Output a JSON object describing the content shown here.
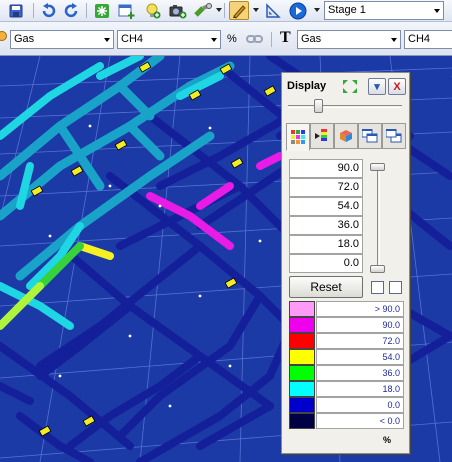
{
  "toolbar_top": {
    "buttons": [
      {
        "name": "save-icon"
      },
      {
        "name": "undo-icon"
      },
      {
        "name": "redo-icon"
      },
      {
        "name": "snowflake-icon"
      },
      {
        "name": "add-window-icon"
      },
      {
        "name": "bulb-icon"
      },
      {
        "name": "camera-icon"
      },
      {
        "name": "pipe-icon"
      },
      {
        "name": "pen-icon"
      },
      {
        "name": "measure-icon"
      },
      {
        "name": "play-icon"
      }
    ],
    "stage_select": "Stage 1"
  },
  "toolbar_bottom": {
    "color_by_type": "Gas",
    "color_by_field": "CH4",
    "color_units": "%",
    "text_icon": "T",
    "text_by_type": "Gas",
    "text_by_field": "CH4"
  },
  "display_panel": {
    "title": "Display",
    "collapse_label": "▾",
    "close_label": "X",
    "tabs": [
      "color-grid-icon",
      "color-scale-icon",
      "cube-icon",
      "window-front-icon",
      "window-back-icon"
    ],
    "active_tab": 0,
    "opacity_level": 0.25,
    "range_values": [
      "90.0",
      "72.0",
      "54.0",
      "36.0",
      "18.0",
      "0.0"
    ],
    "range_slider_level": 0.0,
    "reset_label": "Reset",
    "legend": [
      {
        "color": "#ff9bf7",
        "label": "> 90.0"
      },
      {
        "color": "#ee00ee",
        "label": "90.0"
      },
      {
        "color": "#ff0000",
        "label": "72.0"
      },
      {
        "color": "#ffff00",
        "label": "54.0"
      },
      {
        "color": "#00ff00",
        "label": "36.0"
      },
      {
        "color": "#00ffff",
        "label": "18.0"
      },
      {
        "color": "#0000cc",
        "label": "0.0"
      },
      {
        "color": "#000044",
        "label": "< 0.0"
      }
    ],
    "unit": "%"
  },
  "scene": {
    "background": "#1c3aa6",
    "grid_color": "#6f88e6",
    "airway_color_low": "#141f9a",
    "airway_color_cyan": "#1fd6e3",
    "airway_color_magenta": "#e91be6",
    "airway_color_yellow": "#f6ef22",
    "airway_color_green": "#37d13b",
    "airway_color_teal": "#1aa3c8"
  }
}
